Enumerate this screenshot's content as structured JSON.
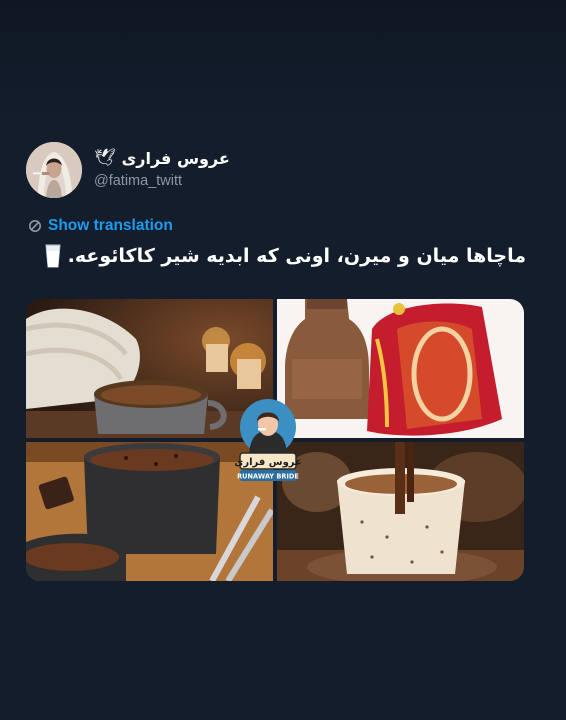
{
  "tweet": {
    "display_name": "عروس فراری",
    "name_icon": "dove-icon",
    "handle": "@fatima_twitt",
    "translate_icon": "translate-icon",
    "translate_label": "Show translation",
    "text": "ماچاها میان و میرن، اونی که ابدیه شیر کاکائوعه.",
    "text_emoji": "milk-glass-icon"
  },
  "media": {
    "watermark": {
      "title": "عروس فراری",
      "subtitle": "RUNAWAY BRIDE"
    },
    "panels": [
      "hot-chocolate-cozy-mug",
      "chocolate-milk-bottle-and-pack",
      "hot-chocolate-dark-mug-spoons",
      "hot-chocolate-speckled-cup"
    ]
  },
  "colors": {
    "background": "#141d2b",
    "link": "#1d9bf0",
    "secondary_text": "#8b98a5",
    "primary_text": "#ffffff"
  }
}
